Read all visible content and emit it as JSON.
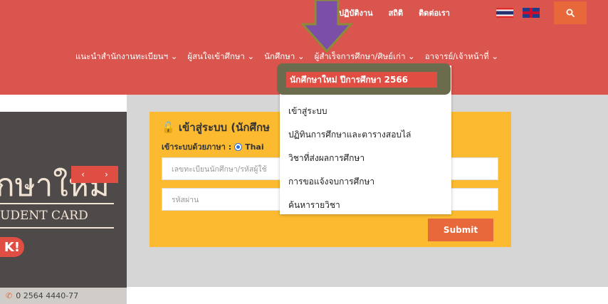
{
  "top_links": [
    "ปฏิบัติงาน",
    "สถิติ",
    "ติดต่อเรา"
  ],
  "nav": {
    "items": [
      "แนะนำสำนักงานทะเบียนฯ ⌄",
      "ผู้สนใจเข้าศึกษา ⌄",
      "นักศึกษา ⌄",
      "ผู้สำเร็จการศึกษา/ศิษย์เก่า ⌄",
      "อาจารย์/เจ้าหน้าที่ ⌄"
    ]
  },
  "dropdown": {
    "highlight": "นักศึกษาใหม่ ปีการศึกษา 2566",
    "items": [
      "เข้าสู่ระบบ",
      "ปฏิทินการศึกษาและตารางสอบไล่",
      "วิชาที่ส่งผลการศึกษา",
      "การขอแจ้งจบการศึกษา",
      "ค้นหารายวิชา"
    ]
  },
  "login": {
    "title": "เข้าสู่ระบบ (นักศึกษ",
    "lang_label": "เข้าระบบด้วยภาษา :",
    "lang_option": "Thai",
    "username_placeholder": "เลขทะเบียนนักศึกษา/รหัสผู้ใช้",
    "password_placeholder": "รหัสผ่าน",
    "submit_label": "Submit"
  },
  "hero": {
    "big_text": "กษาใหม่",
    "card_text": "UDENT CARD",
    "pill_text": "K!",
    "phone": "0 2564 4440-77"
  },
  "colors": {
    "header": "#d9554d",
    "accent": "#e7683a",
    "login_bg": "#fbba30",
    "arrow": "#7b4fa8"
  }
}
